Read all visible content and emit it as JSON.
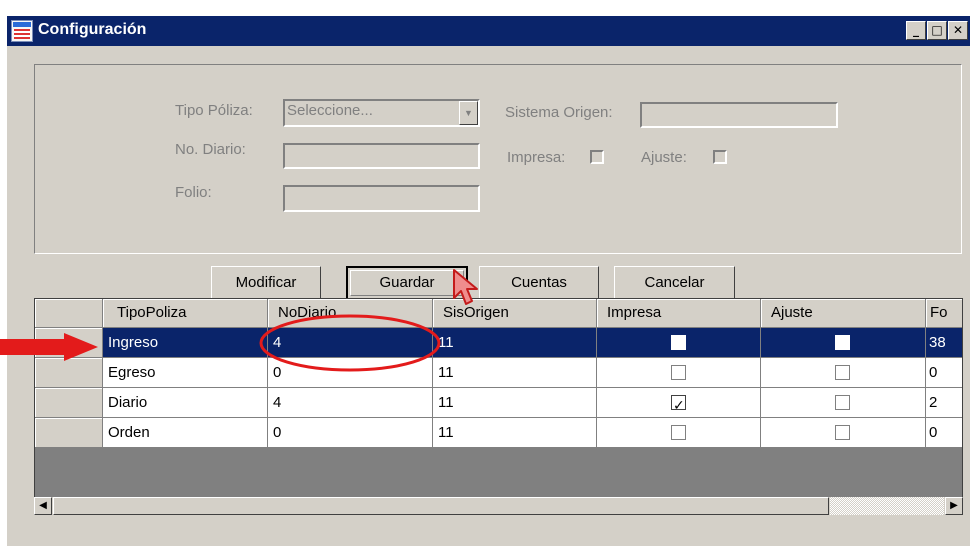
{
  "window": {
    "title": "Configuración",
    "controls": {
      "minimize": "_",
      "maximize": "□",
      "close": "✕"
    }
  },
  "form": {
    "tipo_poliza": {
      "label": "Tipo Póliza:",
      "value": "Seleccione..."
    },
    "sistema_origen": {
      "label": "Sistema Origen:",
      "value": ""
    },
    "no_diario": {
      "label": "No. Diario:",
      "value": ""
    },
    "impresa": {
      "label": "Impresa:",
      "checked": false
    },
    "ajuste": {
      "label": "Ajuste:",
      "checked": false
    },
    "folio": {
      "label": "Folio:",
      "value": ""
    }
  },
  "buttons": {
    "modificar": "Modificar",
    "guardar": "Guardar",
    "cuentas": "Cuentas",
    "cancelar": "Cancelar"
  },
  "grid": {
    "columns": [
      "TipoPoliza",
      "NoDiario",
      "SisOrigen",
      "Impresa",
      "Ajuste",
      "Fo"
    ],
    "rows": [
      {
        "tipo": "Ingreso",
        "nodiario": "4",
        "sisorigen": "11",
        "impresa": false,
        "ajuste": false,
        "folio": "38",
        "selected": true
      },
      {
        "tipo": "Egreso",
        "nodiario": "0",
        "sisorigen": "11",
        "impresa": false,
        "ajuste": false,
        "folio": "0",
        "selected": false
      },
      {
        "tipo": "Diario",
        "nodiario": "4",
        "sisorigen": "11",
        "impresa": true,
        "ajuste": false,
        "folio": "2",
        "selected": false
      },
      {
        "tipo": "Orden",
        "nodiario": "0",
        "sisorigen": "11",
        "impresa": false,
        "ajuste": false,
        "folio": "0",
        "selected": false
      }
    ]
  },
  "scrollbar": {
    "left": "◀",
    "right": "▶"
  },
  "colors": {
    "titlebar": "#0a246a",
    "selection": "#0a246a",
    "face": "#d4d0c8",
    "annotation": "#e31b1b"
  }
}
